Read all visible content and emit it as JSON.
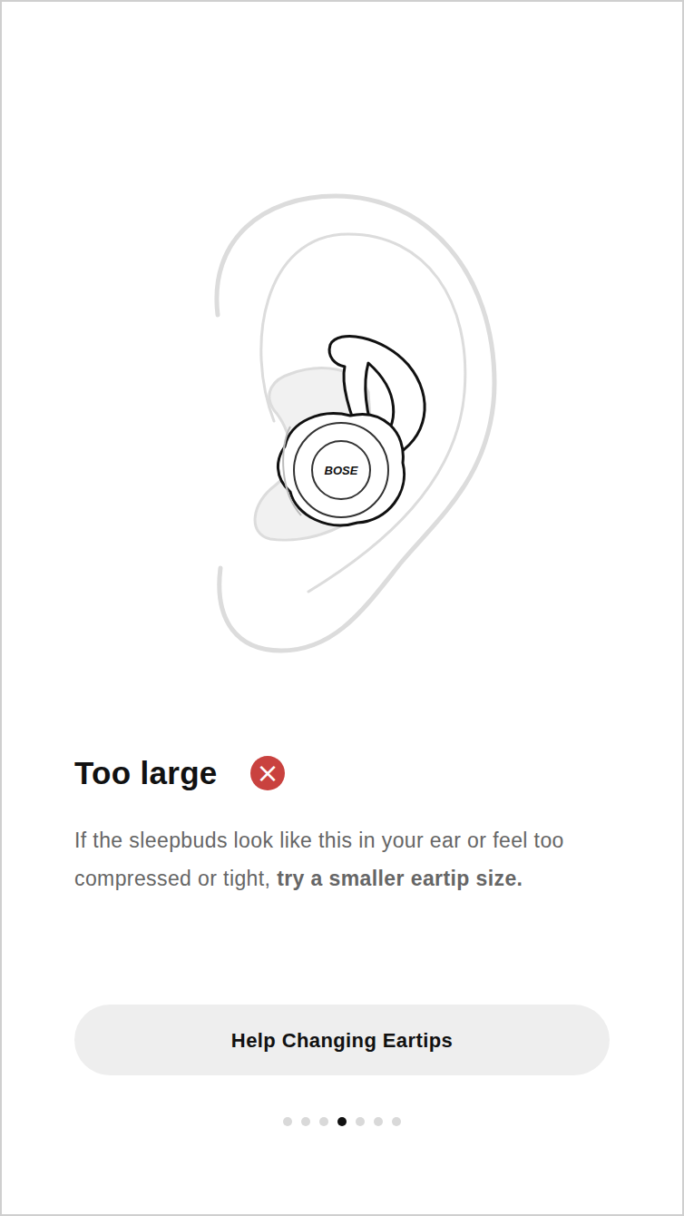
{
  "logo": "BOSE",
  "verdict": {
    "title": "Too large",
    "ok": false,
    "icon": "×"
  },
  "body": {
    "text": "If the sleepbuds look like this in your ear or feel too compressed or tight, ",
    "emphasis": "try a smaller eartip size."
  },
  "button": {
    "label": "Help Changing Eartips"
  },
  "pager": [
    {
      "selected": false
    },
    {
      "selected": false
    },
    {
      "selected": false
    },
    {
      "selected": true
    },
    {
      "selected": false
    },
    {
      "selected": false
    },
    {
      "selected": false
    }
  ]
}
